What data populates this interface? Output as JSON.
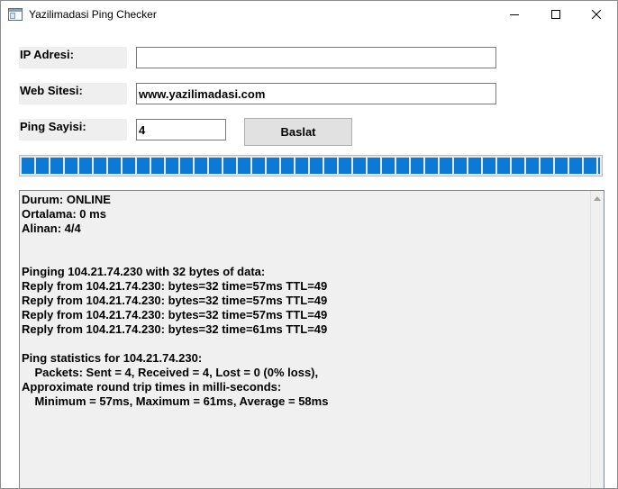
{
  "window": {
    "title": "Yazilimadasi Ping Checker"
  },
  "form": {
    "ip": {
      "label": "IP Adresi:",
      "value": ""
    },
    "website": {
      "label": "Web Sitesi:",
      "value": "www.yazilimadasi.com"
    },
    "ping_count": {
      "label": "Ping Sayisi:",
      "value": "4"
    },
    "start_button": "Baslat"
  },
  "progress": {
    "percent": 100
  },
  "output": {
    "text": "Durum: ONLINE\nOrtalama: 0 ms\nAlinan: 4/4\n\n\nPinging 104.21.74.230 with 32 bytes of data:\nReply from 104.21.74.230: bytes=32 time=57ms TTL=49\nReply from 104.21.74.230: bytes=32 time=57ms TTL=49\nReply from 104.21.74.230: bytes=32 time=57ms TTL=49\nReply from 104.21.74.230: bytes=32 time=61ms TTL=49\n\nPing statistics for 104.21.74.230:\n    Packets: Sent = 4, Received = 4, Lost = 0 (0% loss),\nApproximate round trip times in milli-seconds:\n    Minimum = 57ms, Maximum = 61ms, Average = 58ms"
  },
  "icons": {
    "app": "app-window-icon",
    "minimize": "minimize-icon",
    "maximize": "maximize-icon",
    "close": "close-icon",
    "scroll_up": "scroll-up-arrow-icon"
  },
  "colors": {
    "progress_fill": "#0a7ad6",
    "label_bg": "#efefef",
    "output_bg": "#f0f0f0"
  }
}
